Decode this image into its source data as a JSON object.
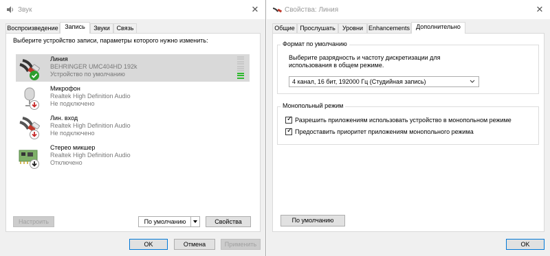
{
  "left_window": {
    "title": "Звук",
    "close_glyph": "✕",
    "tabs": [
      {
        "label": "Воспроизведение",
        "active": false
      },
      {
        "label": "Запись",
        "active": true
      },
      {
        "label": "Звуки",
        "active": false
      },
      {
        "label": "Связь",
        "active": false
      }
    ],
    "instruction": "Выберите устройство записи, параметры которого нужно изменить:",
    "devices": [
      {
        "name": "Линия",
        "line2": "BEHRINGER UMC404HD 192k",
        "line3": "Устройство по умолчанию",
        "selected": true,
        "icon": "line-in-cable-icon",
        "status_icon": "green-check-icon"
      },
      {
        "name": "Микрофон",
        "line2": "Realtek High Definition Audio",
        "line3": "Не подключено",
        "selected": false,
        "icon": "microphone-icon",
        "status_icon": "red-down-arrow-icon"
      },
      {
        "name": "Лин. вход",
        "line2": "Realtek High Definition Audio",
        "line3": "Не подключено",
        "selected": false,
        "icon": "line-in-cable-icon",
        "status_icon": "red-down-arrow-icon"
      },
      {
        "name": "Стерео микшер",
        "line2": "Realtek High Definition Audio",
        "line3": "Отключено",
        "selected": false,
        "icon": "circuit-board-icon",
        "status_icon": "black-down-arrow-icon"
      }
    ],
    "level_meter": {
      "segments": 10,
      "lit": 3,
      "lit_color": "#2eb82e",
      "dim_color": "#c8c8c8"
    },
    "configure_label": "Настроить",
    "default_label": "По умолчанию",
    "properties_label": "Свойства",
    "ok_label": "OK",
    "cancel_label": "Отмена",
    "apply_label": "Применить"
  },
  "right_window": {
    "title": "Свойства: Линия",
    "close_glyph": "✕",
    "tabs": [
      {
        "label": "Общие",
        "active": false
      },
      {
        "label": "Прослушать",
        "active": false
      },
      {
        "label": "Уровни",
        "active": false
      },
      {
        "label": "Enhancements",
        "active": false
      },
      {
        "label": "Дополнительно",
        "active": true
      }
    ],
    "format_group": {
      "label": "Формат по умолчанию",
      "description_line1": "Выберите разрядность и частоту дискретизации для",
      "description_line2": "использования в общем режиме.",
      "selected_format": "4 канал, 16 бит, 192000 Гц (Студийная запись)"
    },
    "exclusive_group": {
      "label": "Монопольный режим",
      "options": [
        {
          "label": "Разрешить приложениям использовать устройство в монопольном режиме",
          "checked": true
        },
        {
          "label": "Предоставить приоритет приложениям монопольного режима",
          "checked": true
        }
      ]
    },
    "restore_default_label": "По умолчанию",
    "ok_label": "OK"
  },
  "colors": {
    "accent": "#0078d7",
    "selected_row": "#d9d9d9",
    "window_bg": "#f0f0f0"
  }
}
